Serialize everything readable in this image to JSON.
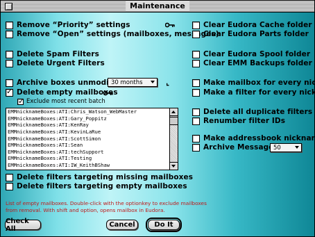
{
  "window": {
    "title": "Maintenance"
  },
  "left": {
    "remove_priority": {
      "label": "Remove “Priority” settings",
      "checked": false
    },
    "remove_open": {
      "label": "Remove “Open” settings (mailboxes, messages)",
      "checked": false
    },
    "delete_spam": {
      "label": "Delete Spam Filters",
      "checked": false
    },
    "delete_urgent": {
      "label": "Delete Urgent Filters",
      "checked": false
    },
    "archive_unmodified": {
      "label": "Archive boxes unmodified:",
      "checked": false,
      "popup_value": "30 months"
    },
    "delete_empty": {
      "label": "Delete empty mailboxes",
      "checked": true
    },
    "exclude_recent": {
      "label": "Exclude most recent batch",
      "checked": true
    },
    "mailbox_list": [
      "EMMnicknameBoxes:ATI:Chris_Watson_WebMaster",
      "EMMnicknameBoxes:ATI:Gary_Poppitz",
      "EMMnicknameBoxes:ATI:KenRay",
      "EMMnicknameBoxes:ATI:KevinLaRue",
      "EMMnicknameBoxes:ATI:ScottSimon",
      "EMMnicknameBoxes:ATI:Sean",
      "EMMnicknameBoxes:ATI:techSupport",
      "EMMnicknameBoxes:ATI:Testing",
      "EMMnicknameBoxes:ATI:IW_KeithBShaw"
    ],
    "delete_missing_targets": {
      "label": "Delete filters targeting missing mailboxes",
      "checked": false
    },
    "delete_empty_targets": {
      "label": "Delete filters targeting empty mailboxes",
      "checked": false
    },
    "help_text": "List of empty mailboxes. Double-click with the optionkey to exclude mailboxes from removal. With shift and option, opens mailbox in Eudora."
  },
  "right": {
    "clear_cache": {
      "label": "Clear Eudora Cache folder",
      "checked": false
    },
    "clear_parts": {
      "label": "Clear Eudora Parts folder",
      "checked": false
    },
    "clear_spool": {
      "label": "Clear Eudora Spool folder",
      "checked": false
    },
    "clear_emm_backups": {
      "label": "Clear EMM Backups folder",
      "checked": false
    },
    "make_mailbox": {
      "label": "Make mailbox for every nickname",
      "checked": false
    },
    "make_filter": {
      "label": "Make a filter for every nickname",
      "checked": false
    },
    "delete_duplicate": {
      "label": "Delete all duplicate filters",
      "checked": false
    },
    "renumber_filter": {
      "label": "Renumber filter IDs",
      "checked": false
    },
    "make_addressbook": {
      "label": "Make addressbook nicknames",
      "checked": false
    },
    "archive_messages": {
      "label": "Archive Messages",
      "checked": false,
      "popup_value": "50"
    }
  },
  "buttons": {
    "check_all": "Check All",
    "cancel": "Cancel",
    "do_it": "Do It"
  },
  "icons": {
    "key": "key-icon",
    "hourglass": "hourglass-icon"
  }
}
